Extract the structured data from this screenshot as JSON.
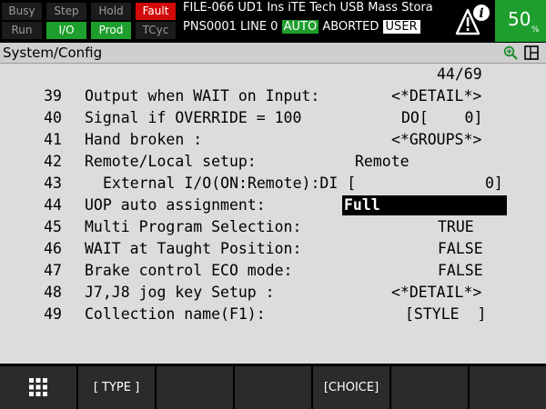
{
  "status": {
    "indicators": [
      {
        "label": "Busy",
        "bg": "#1c1c1c",
        "fg": "#9a9a9a"
      },
      {
        "label": "Step",
        "bg": "#1c1c1c",
        "fg": "#9a9a9a"
      },
      {
        "label": "Hold",
        "bg": "#1c1c1c",
        "fg": "#9a9a9a"
      },
      {
        "label": "Fault",
        "bg": "#d20a0a",
        "fg": "#ffffff"
      },
      {
        "label": "Run",
        "bg": "#1c1c1c",
        "fg": "#9a9a9a"
      },
      {
        "label": "I/O",
        "bg": "#1e9e2c",
        "fg": "#ffffff"
      },
      {
        "label": "Prod",
        "bg": "#1e9e2c",
        "fg": "#ffffff"
      },
      {
        "label": "TCyc",
        "bg": "#1c1c1c",
        "fg": "#9a9a9a"
      }
    ],
    "line1": "FILE-066 UD1 Ins iTE Tech USB Mass Stora",
    "line2_prefix": "PNS0001 LINE 0",
    "mode": "AUTO",
    "state": "ABORTED",
    "user": "USER",
    "override_value": "50",
    "override_unit": "%"
  },
  "title": "System/Config",
  "page_indicator": "44/69",
  "rows": [
    {
      "num": "39",
      "label": "Output when WAIT on Input:",
      "value": "<*DETAIL*>"
    },
    {
      "num": "40",
      "label": "Signal if OVERRIDE = 100",
      "value": "DO[    0]"
    },
    {
      "num": "41",
      "label": "Hand broken :",
      "value": "<*GROUPS*>"
    },
    {
      "num": "42",
      "label": "Remote/Local setup:",
      "value": "Remote"
    },
    {
      "num": "43",
      "label": "External I/O(ON:Remote):DI [",
      "value": "0]"
    },
    {
      "num": "44",
      "label": "UOP auto assignment:",
      "value": "Full"
    },
    {
      "num": "45",
      "label": "Multi Program Selection:",
      "value": "TRUE"
    },
    {
      "num": "46",
      "label": "WAIT at Taught Position:",
      "value": "FALSE"
    },
    {
      "num": "47",
      "label": "Brake control ECO mode:",
      "value": "FALSE"
    },
    {
      "num": "48",
      "label": "J7,J8 jog key Setup :",
      "value": "<*DETAIL*>"
    },
    {
      "num": "49",
      "label": "Collection name(F1):",
      "value": "[STYLE  ]"
    }
  ],
  "selected_row": "44",
  "fkeys": [
    "",
    "[ TYPE ]",
    "",
    "",
    "[CHOICE]",
    "",
    ""
  ],
  "icons": {
    "menu": "grid-menu-icon",
    "warning": "warning-info-icon",
    "zoom": "zoom-in-icon",
    "layout": "window-layout-icon"
  },
  "colors": {
    "green": "#1e9e2c",
    "fault": "#d20a0a",
    "content_bg": "#dcdcdc",
    "titlebar_bg": "#cfcfcf"
  }
}
